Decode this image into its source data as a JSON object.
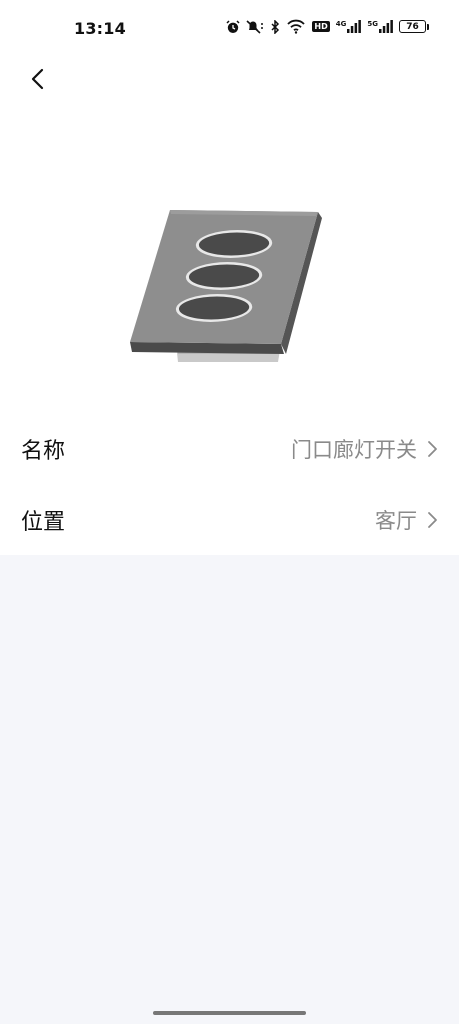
{
  "status_bar": {
    "time": "13:14",
    "network_1": "4G",
    "network_2": "5G",
    "hd_label": "HD",
    "battery_level": "76",
    "icons": [
      "alarm-icon",
      "mute-icon",
      "bluetooth-icon",
      "wifi-icon",
      "hd-icon",
      "signal-4g-icon",
      "signal-5g-icon",
      "battery-icon"
    ]
  },
  "header": {
    "back_icon": "chevron-left-icon"
  },
  "device": {
    "image_icon": "three-gang-wall-switch-image"
  },
  "settings": [
    {
      "label": "名称",
      "value": "门口廊灯开关"
    },
    {
      "label": "位置",
      "value": "客厅"
    }
  ],
  "colors": {
    "page_background": "#f5f6fa",
    "card_background": "#ffffff",
    "value_text": "#8a8a8a"
  }
}
